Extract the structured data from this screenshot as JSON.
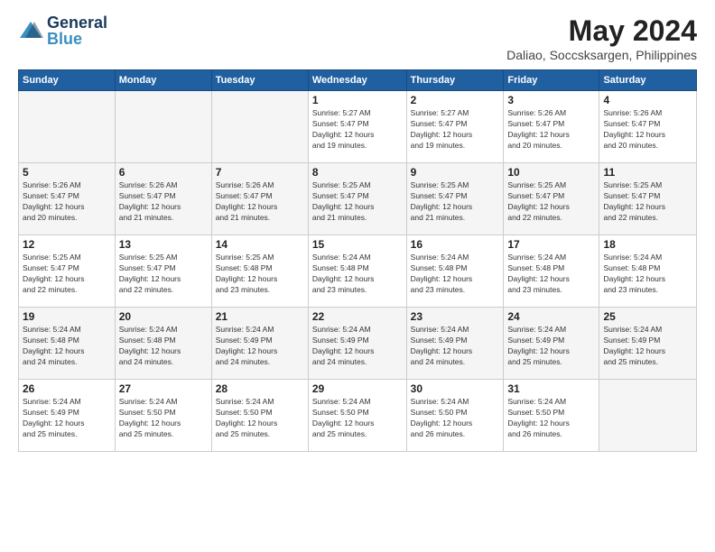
{
  "header": {
    "logo": "General Blue",
    "title": "May 2024",
    "location": "Daliao, Soccsksargen, Philippines"
  },
  "weekdays": [
    "Sunday",
    "Monday",
    "Tuesday",
    "Wednesday",
    "Thursday",
    "Friday",
    "Saturday"
  ],
  "weeks": [
    [
      {
        "day": "",
        "info": ""
      },
      {
        "day": "",
        "info": ""
      },
      {
        "day": "",
        "info": ""
      },
      {
        "day": "1",
        "info": "Sunrise: 5:27 AM\nSunset: 5:47 PM\nDaylight: 12 hours\nand 19 minutes."
      },
      {
        "day": "2",
        "info": "Sunrise: 5:27 AM\nSunset: 5:47 PM\nDaylight: 12 hours\nand 19 minutes."
      },
      {
        "day": "3",
        "info": "Sunrise: 5:26 AM\nSunset: 5:47 PM\nDaylight: 12 hours\nand 20 minutes."
      },
      {
        "day": "4",
        "info": "Sunrise: 5:26 AM\nSunset: 5:47 PM\nDaylight: 12 hours\nand 20 minutes."
      }
    ],
    [
      {
        "day": "5",
        "info": "Sunrise: 5:26 AM\nSunset: 5:47 PM\nDaylight: 12 hours\nand 20 minutes."
      },
      {
        "day": "6",
        "info": "Sunrise: 5:26 AM\nSunset: 5:47 PM\nDaylight: 12 hours\nand 21 minutes."
      },
      {
        "day": "7",
        "info": "Sunrise: 5:26 AM\nSunset: 5:47 PM\nDaylight: 12 hours\nand 21 minutes."
      },
      {
        "day": "8",
        "info": "Sunrise: 5:25 AM\nSunset: 5:47 PM\nDaylight: 12 hours\nand 21 minutes."
      },
      {
        "day": "9",
        "info": "Sunrise: 5:25 AM\nSunset: 5:47 PM\nDaylight: 12 hours\nand 21 minutes."
      },
      {
        "day": "10",
        "info": "Sunrise: 5:25 AM\nSunset: 5:47 PM\nDaylight: 12 hours\nand 22 minutes."
      },
      {
        "day": "11",
        "info": "Sunrise: 5:25 AM\nSunset: 5:47 PM\nDaylight: 12 hours\nand 22 minutes."
      }
    ],
    [
      {
        "day": "12",
        "info": "Sunrise: 5:25 AM\nSunset: 5:47 PM\nDaylight: 12 hours\nand 22 minutes."
      },
      {
        "day": "13",
        "info": "Sunrise: 5:25 AM\nSunset: 5:47 PM\nDaylight: 12 hours\nand 22 minutes."
      },
      {
        "day": "14",
        "info": "Sunrise: 5:25 AM\nSunset: 5:48 PM\nDaylight: 12 hours\nand 23 minutes."
      },
      {
        "day": "15",
        "info": "Sunrise: 5:24 AM\nSunset: 5:48 PM\nDaylight: 12 hours\nand 23 minutes."
      },
      {
        "day": "16",
        "info": "Sunrise: 5:24 AM\nSunset: 5:48 PM\nDaylight: 12 hours\nand 23 minutes."
      },
      {
        "day": "17",
        "info": "Sunrise: 5:24 AM\nSunset: 5:48 PM\nDaylight: 12 hours\nand 23 minutes."
      },
      {
        "day": "18",
        "info": "Sunrise: 5:24 AM\nSunset: 5:48 PM\nDaylight: 12 hours\nand 23 minutes."
      }
    ],
    [
      {
        "day": "19",
        "info": "Sunrise: 5:24 AM\nSunset: 5:48 PM\nDaylight: 12 hours\nand 24 minutes."
      },
      {
        "day": "20",
        "info": "Sunrise: 5:24 AM\nSunset: 5:48 PM\nDaylight: 12 hours\nand 24 minutes."
      },
      {
        "day": "21",
        "info": "Sunrise: 5:24 AM\nSunset: 5:49 PM\nDaylight: 12 hours\nand 24 minutes."
      },
      {
        "day": "22",
        "info": "Sunrise: 5:24 AM\nSunset: 5:49 PM\nDaylight: 12 hours\nand 24 minutes."
      },
      {
        "day": "23",
        "info": "Sunrise: 5:24 AM\nSunset: 5:49 PM\nDaylight: 12 hours\nand 24 minutes."
      },
      {
        "day": "24",
        "info": "Sunrise: 5:24 AM\nSunset: 5:49 PM\nDaylight: 12 hours\nand 25 minutes."
      },
      {
        "day": "25",
        "info": "Sunrise: 5:24 AM\nSunset: 5:49 PM\nDaylight: 12 hours\nand 25 minutes."
      }
    ],
    [
      {
        "day": "26",
        "info": "Sunrise: 5:24 AM\nSunset: 5:49 PM\nDaylight: 12 hours\nand 25 minutes."
      },
      {
        "day": "27",
        "info": "Sunrise: 5:24 AM\nSunset: 5:50 PM\nDaylight: 12 hours\nand 25 minutes."
      },
      {
        "day": "28",
        "info": "Sunrise: 5:24 AM\nSunset: 5:50 PM\nDaylight: 12 hours\nand 25 minutes."
      },
      {
        "day": "29",
        "info": "Sunrise: 5:24 AM\nSunset: 5:50 PM\nDaylight: 12 hours\nand 25 minutes."
      },
      {
        "day": "30",
        "info": "Sunrise: 5:24 AM\nSunset: 5:50 PM\nDaylight: 12 hours\nand 26 minutes."
      },
      {
        "day": "31",
        "info": "Sunrise: 5:24 AM\nSunset: 5:50 PM\nDaylight: 12 hours\nand 26 minutes."
      },
      {
        "day": "",
        "info": ""
      }
    ]
  ]
}
